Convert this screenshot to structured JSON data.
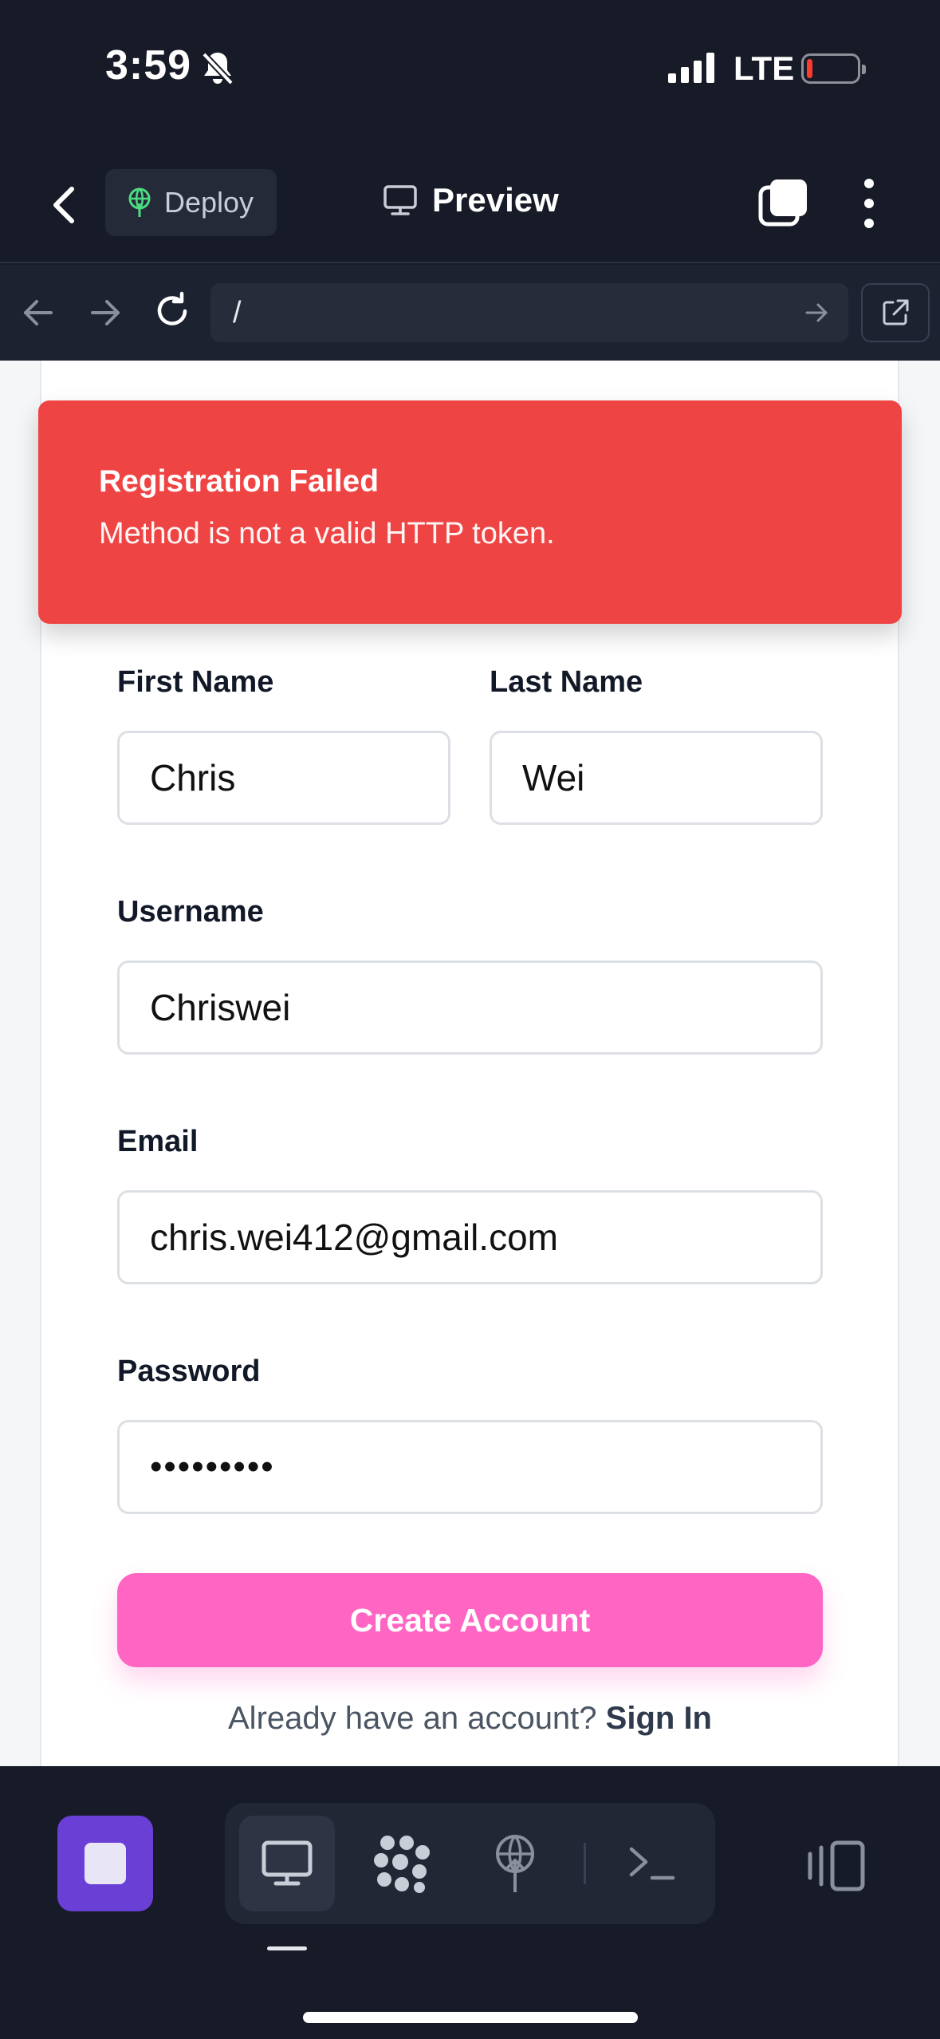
{
  "status_bar": {
    "time": "3:59",
    "network": "LTE",
    "battery_level": 0.12
  },
  "header": {
    "deploy_label": "Deploy",
    "title": "Preview"
  },
  "url_bar": {
    "url": "/"
  },
  "alert": {
    "title": "Registration Failed",
    "message": "Method is not a valid HTTP token."
  },
  "form": {
    "first_name_label": "First Name",
    "first_name_value": "Chris",
    "last_name_label": "Last Name",
    "last_name_value": "Wei",
    "username_label": "Username",
    "username_value": "Chriswei",
    "email_label": "Email",
    "email_value": "chris.wei412@gmail.com",
    "password_label": "Password",
    "password_value": "•••••••••",
    "submit_label": "Create Account",
    "signin_prompt": "Already have an account?",
    "signin_link": "Sign In"
  },
  "colors": {
    "alert_bg": "#ef4444",
    "submit_bg": "#ff66c4",
    "stop_button_bg": "#6a3fd6",
    "dark_bg": "#171b27"
  },
  "icons": {
    "header": [
      "chevron-left-icon",
      "deploy-icon",
      "monitor-icon",
      "tabs-icon",
      "more-vertical-icon"
    ],
    "url_bar": [
      "arrow-left-icon",
      "arrow-right-icon",
      "reload-icon",
      "go-arrow-icon",
      "external-link-icon"
    ],
    "toolbar": [
      "stop-icon",
      "monitor-icon",
      "packages-icon",
      "deploy-icon",
      "terminal-icon",
      "panel-icon"
    ]
  }
}
